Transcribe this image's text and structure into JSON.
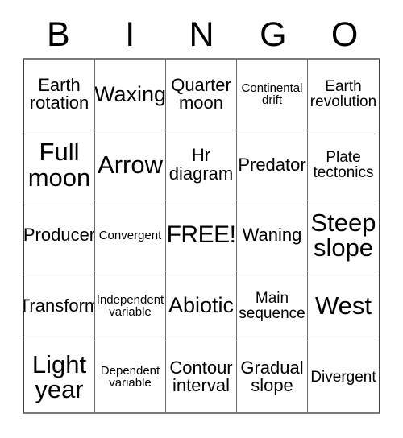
{
  "card": {
    "title_letters": [
      "B",
      "I",
      "N",
      "G",
      "O"
    ],
    "free_space_label": "FREE!",
    "grid": [
      [
        {
          "label": "Earth\nrotation",
          "size": "md"
        },
        {
          "label": "Waxing",
          "size": "lg"
        },
        {
          "label": "Quarter\nmoon",
          "size": "md"
        },
        {
          "label": "Continental\ndrift",
          "size": "xs"
        },
        {
          "label": "Earth\nrevolution",
          "size": "sm"
        }
      ],
      [
        {
          "label": "Full\nmoon",
          "size": "xl"
        },
        {
          "label": "Arrow",
          "size": "xl"
        },
        {
          "label": "Hr\ndiagram",
          "size": "md"
        },
        {
          "label": "Predator",
          "size": "md"
        },
        {
          "label": "Plate\ntectonics",
          "size": "sm"
        }
      ],
      [
        {
          "label": "Producer",
          "size": "md"
        },
        {
          "label": "Convergent",
          "size": "xs"
        },
        {
          "label": "FREE!",
          "size": "free"
        },
        {
          "label": "Waning",
          "size": "md"
        },
        {
          "label": "Steep\nslope",
          "size": "xl"
        }
      ],
      [
        {
          "label": "Transform",
          "size": "md"
        },
        {
          "label": "Independent\nvariable",
          "size": "xs"
        },
        {
          "label": "Abiotic",
          "size": "lg"
        },
        {
          "label": "Main\nsequence",
          "size": "sm"
        },
        {
          "label": "West",
          "size": "xl"
        }
      ],
      [
        {
          "label": "Light\nyear",
          "size": "xl"
        },
        {
          "label": "Dependent\nvariable",
          "size": "xs"
        },
        {
          "label": "Contour\ninterval",
          "size": "md"
        },
        {
          "label": "Gradual\nslope",
          "size": "md"
        },
        {
          "label": "Divergent",
          "size": "sm"
        }
      ]
    ]
  }
}
